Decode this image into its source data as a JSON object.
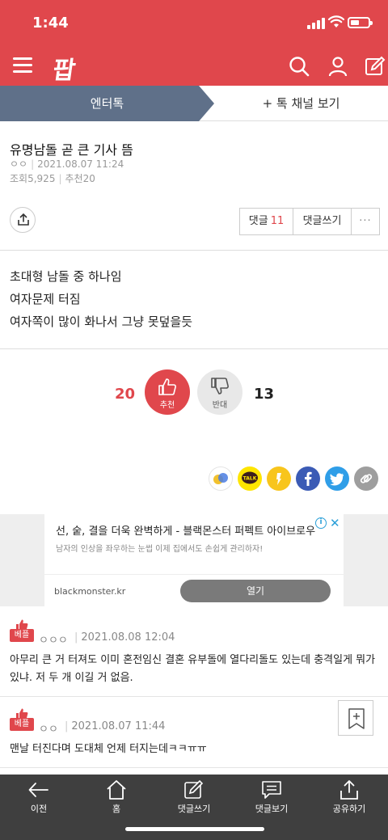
{
  "status_bar": {
    "time": "1:44"
  },
  "app_bar": {
    "logo_text": "팝"
  },
  "channel_bar": {
    "current_channel": "엔터톡",
    "more_channels": "+ 톡 채널 보기"
  },
  "post": {
    "title": "유명남돌 곧 큰 기사 뜸",
    "author": "ㅇㅇ",
    "date": "2021.08.07 11:24",
    "views_label": "조회",
    "views": "5,925",
    "recommend_label": "추천",
    "recommend": "20",
    "comment_label": "댓글",
    "comment_count": "11",
    "write_comment_label": "댓글쓰기",
    "more_label": "···",
    "body_lines": [
      "초대형 남돌 중 하나임",
      "여자문제 터짐",
      "여자쪽이 많이 화나서 그냥 못덮을듯"
    ]
  },
  "vote": {
    "up_count": "20",
    "up_label": "추천",
    "down_count": "13",
    "down_label": "반대"
  },
  "share_icons": [
    "band",
    "kakaotalk",
    "kakaostory",
    "facebook",
    "twitter",
    "link"
  ],
  "ad": {
    "title": "선, 숱, 결을 더욱 완벽하게 - 블랙몬스터 퍼펙트 아이브로우",
    "subtitle": "남자의 인상을 좌우하는 눈썹 이제 집에서도 손쉽게 관리하자!",
    "domain": "blackmonster.kr",
    "open_label": "열기",
    "info_mark": "i",
    "close_mark": "✕"
  },
  "comments": [
    {
      "badge": "베플",
      "author": "ㅇㅇㅇ",
      "date": "2021.08.08 12:04",
      "text": "아무리 큰 거 터져도 이미 혼전임신 결혼 유부돌에 열다리돌도 있는데 충격일게 뭐가 있냐. 저 두 개 이길 거 없음."
    },
    {
      "badge": "베플",
      "author": "ㅇㅇ",
      "date": "2021.08.07 11:44",
      "text": "맨날 터진다며 도대체 언제 터지는데ㅋㅋㅠㅠ"
    }
  ],
  "tab_bar": {
    "items": [
      {
        "label": "이전",
        "icon": "back-arrow-icon"
      },
      {
        "label": "홈",
        "icon": "home-icon"
      },
      {
        "label": "댓글쓰기",
        "icon": "pencil-icon"
      },
      {
        "label": "댓글보기",
        "icon": "speech-bubble-icon"
      },
      {
        "label": "공유하기",
        "icon": "share-icon"
      }
    ]
  },
  "colors": {
    "brand_red": "#e0474c",
    "channel_slate": "#5f7089",
    "tab_bar": "#3f3f3f"
  }
}
